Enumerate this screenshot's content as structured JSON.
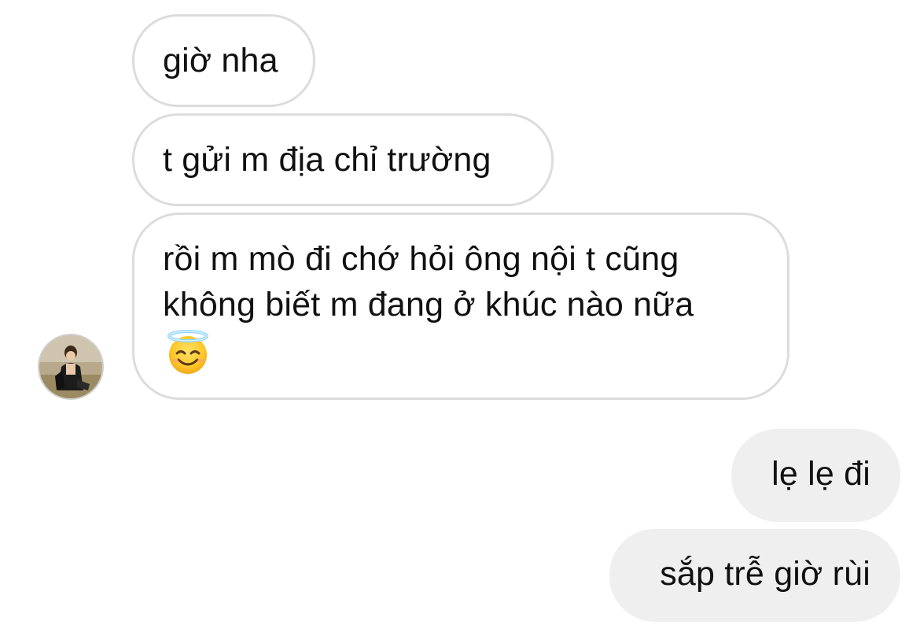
{
  "conversation": {
    "incoming": [
      {
        "text": "giờ nha"
      },
      {
        "text": "t gửi m địa chỉ trường"
      },
      {
        "lines": [
          "rồi m mò đi chớ hỏi ông nội t cũng",
          "không biết m đang ở khúc nào nữa"
        ],
        "emoji": "smiling-face-with-halo"
      }
    ],
    "outgoing": [
      {
        "text": "lẹ lẹ đi"
      },
      {
        "text": "sắp trễ giờ rùi"
      }
    ],
    "sender_avatar": "profile-photo"
  },
  "colors": {
    "incoming_border": "#dcdcdc",
    "outgoing_fill": "#efefef",
    "text": "#111111"
  }
}
